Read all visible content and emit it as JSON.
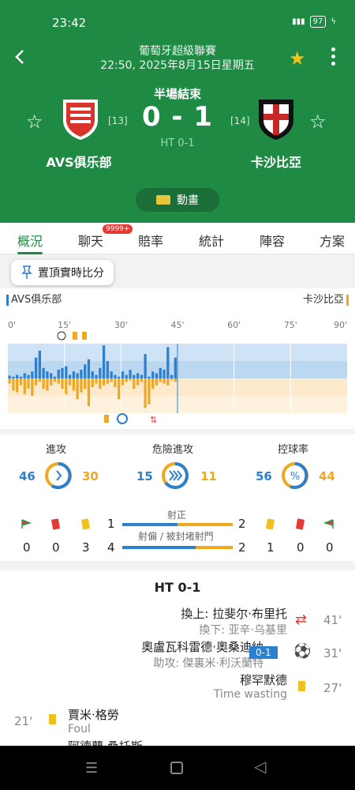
{
  "status_bar": {
    "time": "23:42",
    "battery": "97"
  },
  "header": {
    "league": "葡萄牙超級聯賽",
    "datetime": "22:50, 2025年8月15日星期五",
    "match_status": "半場結束",
    "score": "0 - 1",
    "ht_score": "HT 0-1",
    "home": {
      "name": "AVS俱乐部",
      "rank": "[13]"
    },
    "away": {
      "name": "卡沙比亞",
      "rank": "[14]"
    },
    "animation_label": "動畫"
  },
  "tabs": [
    {
      "label": "概況"
    },
    {
      "label": "聊天"
    },
    {
      "label": "賠率"
    },
    {
      "label": "統計"
    },
    {
      "label": "陣容"
    },
    {
      "label": "方案"
    }
  ],
  "chat_badge": "9999+",
  "pin_button": "置頂實時比分",
  "timeline": {
    "home_label": "AVS俱乐部",
    "away_label": "卡沙比亞",
    "minute_ticks": [
      "0'",
      "15'",
      "30'",
      "45'",
      "60'",
      "75'",
      "90'"
    ],
    "home_pressure": [
      0.08,
      0.05,
      0.1,
      0.05,
      0.15,
      0.1,
      0.2,
      0.6,
      0.8,
      0.3,
      0.2,
      0.15,
      0.05,
      0.25,
      0.3,
      0.35,
      0.1,
      0.2,
      0.15,
      0.25,
      0.4,
      0.55,
      0.2,
      0.1,
      0.3,
      0.95,
      0.5,
      0.2,
      0.1,
      0.05,
      0.2,
      0.1,
      0.25,
      0.1,
      0.15,
      0.1,
      0.7,
      0.05,
      0.2,
      0.15,
      0.3,
      0.25,
      0.9,
      0.1,
      0.6
    ],
    "away_pressure": [
      0.15,
      0.35,
      0.4,
      0.2,
      0.45,
      0.3,
      0.5,
      0.2,
      0.1,
      0.3,
      0.35,
      0.2,
      0.1,
      0.15,
      0.3,
      0.45,
      0.2,
      0.35,
      0.6,
      0.4,
      0.3,
      0.8,
      0.25,
      0.15,
      0.3,
      0.2,
      0.15,
      0.1,
      0.25,
      0.6,
      0.2,
      0.1,
      0.05,
      0.3,
      0.2,
      0.1,
      0.85,
      0.75,
      0.3,
      0.2,
      0.1,
      0.15,
      0.2,
      0.05,
      0.1
    ],
    "colors": {
      "home": "#2d7fd0",
      "away": "#f0a820"
    }
  },
  "stats": {
    "attack": {
      "label": "進攻",
      "home": "46",
      "away": "30"
    },
    "dangerous": {
      "label": "危險進攻",
      "home": "15",
      "away": "11"
    },
    "possession": {
      "label": "控球率",
      "home": "56",
      "away": "44"
    },
    "on_target": {
      "label": "射正",
      "home": "1",
      "away": "2"
    },
    "off_target": {
      "label": "射偏 / 被封堵射門",
      "home": "4",
      "away": "2"
    },
    "home_corners": "0",
    "home_red": "0",
    "home_yellow": "3",
    "away_yellow": "1",
    "away_red": "0",
    "away_corners": "0"
  },
  "events": {
    "ht_title": "HT 0-1",
    "items": [
      {
        "main": "換上: 拉斐尔·布里托",
        "sub": "換下: 亚辛·乌基里",
        "minute": "41'"
      },
      {
        "main": "奧盧瓦科雷德·奧桑迪納",
        "sub": "助攻: 傑裏米·利沃蘭特",
        "minute": "31'",
        "score": "0-1"
      },
      {
        "main": "穆罕默德",
        "sub": "Time wasting",
        "minute": "27'"
      },
      {
        "main": "賈米·格勞",
        "sub": "Foul",
        "minute": "21'"
      },
      {
        "main": "阿德蘭·桑托斯",
        "sub": "",
        "minute": ""
      }
    ]
  }
}
